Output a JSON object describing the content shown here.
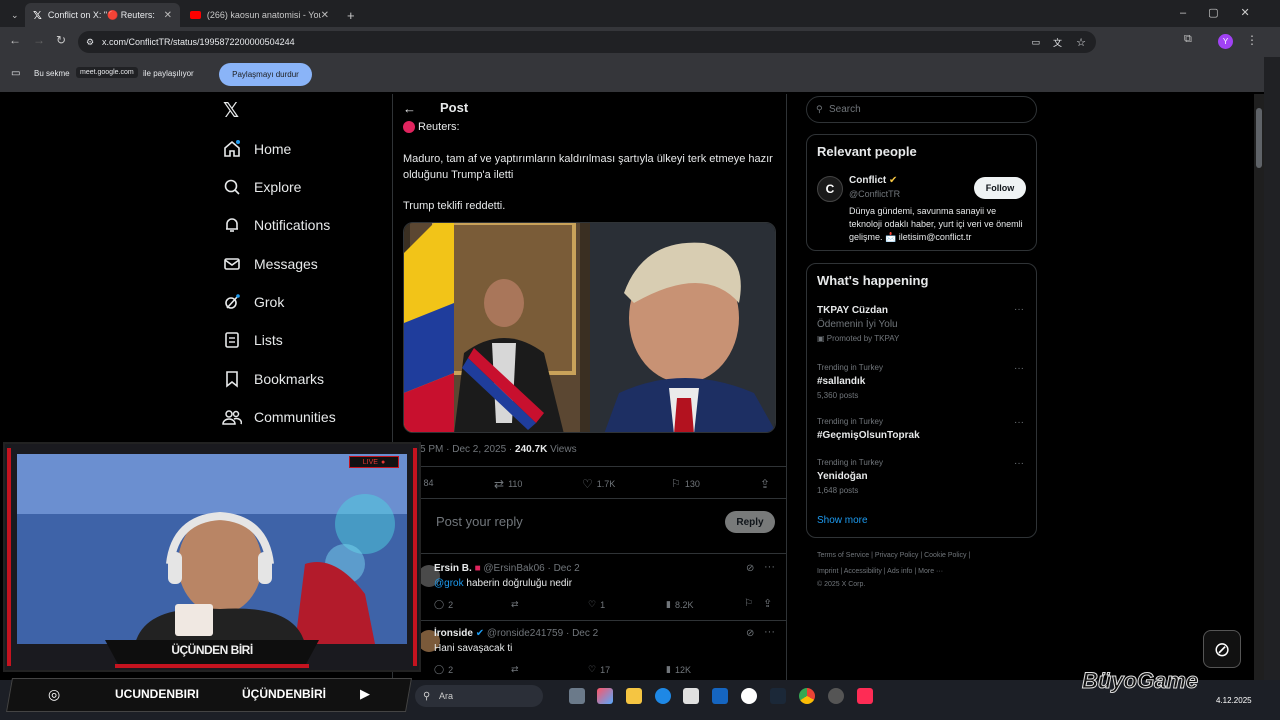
{
  "browser": {
    "tabs": [
      {
        "label": "Conflict on X: \"🔴 Reuters: M..."
      },
      {
        "label": "(266) kaosun anatomisi - YouTu..."
      }
    ],
    "new_tab": "+",
    "url": "x.com/ConflictTR/status/1995872200000504244",
    "share_bar": {
      "prefix": "Bu sekme",
      "host": "meet.google.com",
      "suffix": "ile paylaşılıyor",
      "stop_label": "Paylaşmayı durdur"
    },
    "profile_letter": "Y"
  },
  "nav": {
    "items": [
      {
        "label": "Home"
      },
      {
        "label": "Explore"
      },
      {
        "label": "Notifications"
      },
      {
        "label": "Messages"
      },
      {
        "label": "Grok"
      },
      {
        "label": "Lists"
      },
      {
        "label": "Bookmarks"
      },
      {
        "label": "Communities"
      }
    ]
  },
  "post": {
    "header": "Post",
    "source_line": "Reuters:",
    "text1": "Maduro, tam af ve yaptırımların kaldırılması şartıyla ülkeyi terk etmeye hazır olduğunu Trump'a iletti",
    "text2": "Trump teklifi reddetti.",
    "meta_time": "5 PM · Dec 2, 2025 · ",
    "views_count": "240.7K",
    "views_label": " Views",
    "stats": {
      "replies": "84",
      "reposts": "110",
      "likes": "1.7K",
      "bookmarks": "130"
    },
    "reply_placeholder": "Post your reply",
    "reply_button": "Reply"
  },
  "comments": [
    {
      "name": "Ersin B.",
      "handle": "@ErsinBak06 · Dec 2",
      "mention": "@grok",
      "text": " haberin doğruluğu nedir",
      "replies": "2",
      "likes": "1",
      "views": "8.2K"
    },
    {
      "name": "İronside",
      "handle": "@ronside241759 · Dec 2",
      "mention": "",
      "text": "Hani savaşacak ti",
      "replies": "2",
      "likes": "17",
      "views": "12K"
    }
  ],
  "sidebar": {
    "search_placeholder": "Search",
    "relevant_title": "Relevant people",
    "person": {
      "name": "Conflict",
      "handle": "@ConflictTR",
      "follow": "Follow",
      "bio": "Dünya gündemi, savunma sanayii ve teknoloji odaklı haber, yurt içi veri ve önemli gelişme. 📩 iletisim@conflict.tr"
    },
    "happening_title": "What's happening",
    "trends": [
      {
        "context": "",
        "name": "TKPAY Cüzdan",
        "sub": "Ödemenin İyi Yolu",
        "extra": "Promoted by TKPAY"
      },
      {
        "context": "Trending in Turkey",
        "name": "#sallandık",
        "sub": "5,360 posts",
        "extra": ""
      },
      {
        "context": "Trending in Turkey",
        "name": "#GeçmişOlsunToprak",
        "sub": "",
        "extra": ""
      },
      {
        "context": "Trending in Turkey",
        "name": "Yenidoğan",
        "sub": "1,648 posts",
        "extra": ""
      }
    ],
    "show_more": "Show more",
    "footer_line1": "Terms of Service  |  Privacy Policy  |  Cookie Policy  |",
    "footer_line2": "Imprint  |  Accessibility  |  Ads info  |  More ···",
    "footer_line3": "© 2025 X Corp."
  },
  "stream": {
    "live": "LIVE",
    "name_plate": "ÜÇÜNDEN BİRİ",
    "social1": "UCUNDENBIRI",
    "social2": "ÜÇÜNDENBİRİ"
  },
  "taskbar": {
    "search": "Ara",
    "date": "4.12.2025",
    "brand": "BüyoGame"
  }
}
